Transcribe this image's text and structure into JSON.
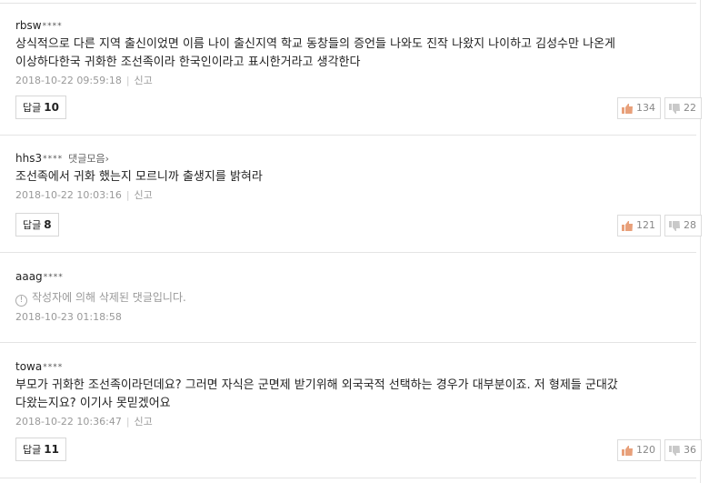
{
  "comments": [
    {
      "author": "rbsw",
      "mask": "****",
      "text_lines": [
        "상식적으로 다른 지역 출신이었면 이름 나이 출신지역 학교 동창들의 증언들 나와도 진작 나왔지 나이하고 김성수만 나온게",
        "이상하다한국 귀화한 조선족이라 한국인이라고 표시한거라고 생각한다"
      ],
      "timestamp": "2018-10-22 09:59:18",
      "report": "신고",
      "reply_label": "답글",
      "reply_count": "10",
      "likes": "134",
      "dislikes": "22"
    },
    {
      "author": "hhs3",
      "mask": "****",
      "more_label": "댓글모음",
      "text_lines": [
        "조선족에서 귀화 했는지 모르니까 출생지를 밝혀라"
      ],
      "timestamp": "2018-10-22 10:03:16",
      "report": "신고",
      "reply_label": "답글",
      "reply_count": "8",
      "likes": "121",
      "dislikes": "28"
    },
    {
      "author": "aaag",
      "mask": "****",
      "deleted_text": "작성자에 의해 삭제된 댓글입니다.",
      "timestamp": "2018-10-23 01:18:58"
    },
    {
      "author": "towa",
      "mask": "****",
      "text_lines": [
        "부모가 귀화한 조선족이라던데요? 그러면 자식은 군면제 받기위해 외국국적 선택하는 경우가 대부분이죠. 저 형제들 군대갔",
        "다왔는지요? 이기사 못믿겠어요"
      ],
      "timestamp": "2018-10-22 10:36:47",
      "report": "신고",
      "reply_label": "답글",
      "reply_count": "11",
      "likes": "120",
      "dislikes": "36"
    }
  ],
  "colors": {
    "thumb_up": "#e8a07a",
    "thumb_down": "#c9c9c9"
  },
  "icons": {
    "like": "thumb-up-icon",
    "dislike": "thumb-down-icon",
    "info": "info-circle-icon",
    "chevron": "chevron-right-icon"
  }
}
